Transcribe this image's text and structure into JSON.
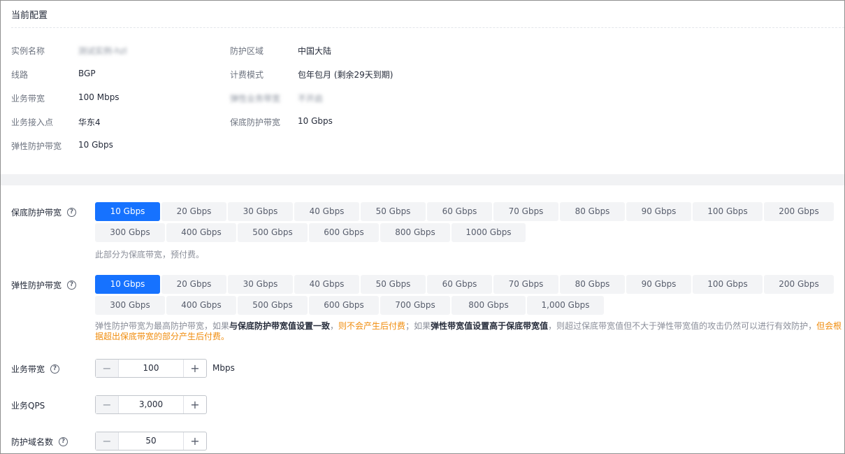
{
  "config": {
    "title": "当前配置",
    "left": [
      {
        "label": "实例名称",
        "value": "测试实例-hzl"
      },
      {
        "label": "线路",
        "value": "BGP"
      },
      {
        "label": "业务带宽",
        "value": "100 Mbps"
      },
      {
        "label": "业务接入点",
        "value": "华东4"
      },
      {
        "label": "弹性防护带宽",
        "value": "10 Gbps"
      }
    ],
    "right": [
      {
        "label": "防护区域",
        "value": "中国大陆"
      },
      {
        "label": "计费模式",
        "value": "包年包月 (剩余29天到期)"
      },
      {
        "label": "弹性业务带宽",
        "value": "不开启"
      },
      {
        "label": "保底防护带宽",
        "value": "10 Gbps"
      }
    ]
  },
  "base_bw": {
    "label": "保底防护带宽",
    "row1": [
      "10 Gbps",
      "20 Gbps",
      "30 Gbps",
      "40 Gbps",
      "50 Gbps",
      "60 Gbps",
      "70 Gbps",
      "80 Gbps",
      "90 Gbps",
      "100 Gbps",
      "200 Gbps"
    ],
    "row2": [
      "300 Gbps",
      "400 Gbps",
      "500 Gbps",
      "600 Gbps",
      "800 Gbps",
      "1000 Gbps"
    ],
    "selected": "10 Gbps",
    "hint": "此部分为保底带宽，预付费。"
  },
  "elastic_bw": {
    "label": "弹性防护带宽",
    "row1": [
      "10 Gbps",
      "20 Gbps",
      "30 Gbps",
      "40 Gbps",
      "50 Gbps",
      "60 Gbps",
      "70 Gbps",
      "80 Gbps",
      "90 Gbps",
      "100 Gbps",
      "200 Gbps"
    ],
    "row2": [
      "300 Gbps",
      "400 Gbps",
      "500 Gbps",
      "600 Gbps",
      "700 Gbps",
      "800 Gbps",
      "1,000 Gbps"
    ],
    "selected": "10 Gbps",
    "hint_parts": {
      "p1": "弹性防护带宽为最高防护带宽，如果",
      "p2": "与保底防护带宽值设置一致",
      "p3": "，",
      "p4": "则不会产生后付费",
      "p5": "；如果",
      "p6": "弹性带宽值设置高于保底带宽值",
      "p7": "，则超过保底带宽值但不大于弹性带宽值的攻击仍然可以进行有效防护，",
      "p8": "但会根据超出保底带宽的部分产生后付费。"
    }
  },
  "business_bw": {
    "label": "业务带宽",
    "value": "100",
    "unit": "Mbps"
  },
  "qps": {
    "label": "业务QPS",
    "value": "3,000"
  },
  "domains": {
    "label": "防护域名数",
    "value": "50"
  },
  "icons": {
    "help": "?",
    "minus": "−",
    "plus": "+"
  }
}
